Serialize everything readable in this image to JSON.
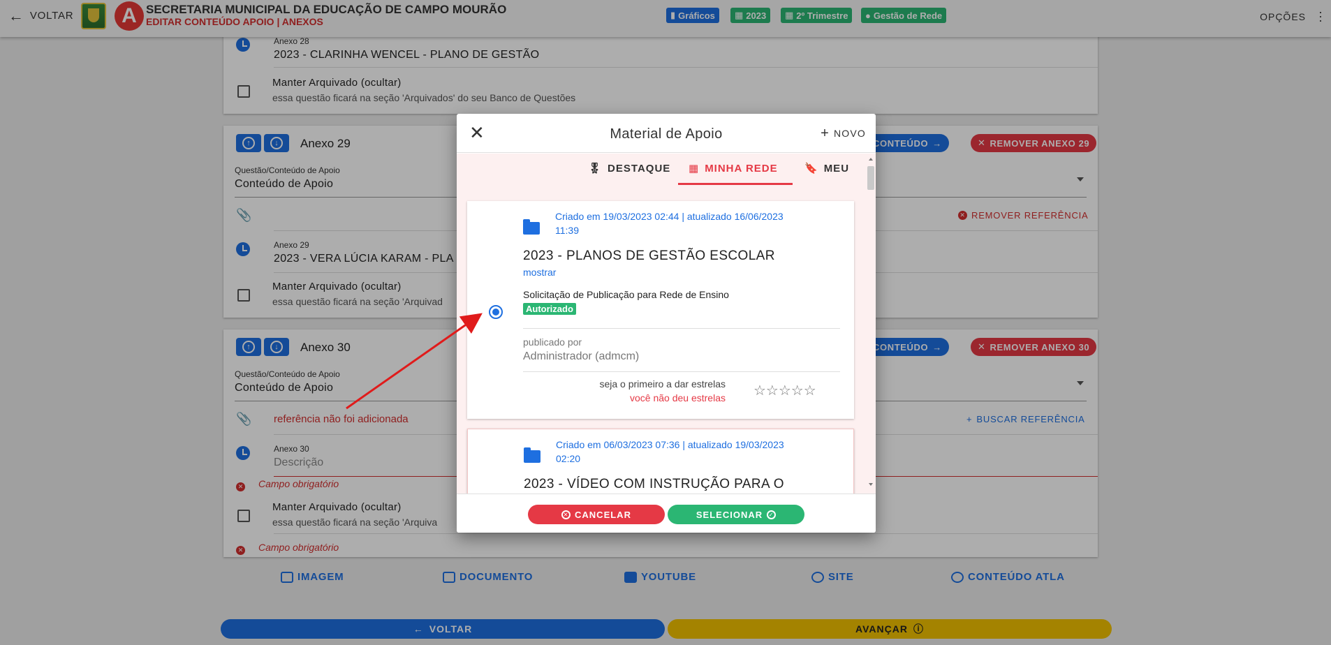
{
  "topbar": {
    "back_label": "VOLTAR",
    "org_title": "SECRETARIA MUNICIPAL DA EDUCAÇÃO DE CAMPO MOURÃO",
    "org_subtitle": "EDITAR CONTEÚDO APOIO | ANEXOS",
    "chips": [
      "Gráficos",
      "2023",
      "2º Trimestre",
      "Gestão de Rede"
    ],
    "options_label": "OPÇÕES"
  },
  "annex28": {
    "label": "Anexo 28",
    "value": "2023 - CLARINHA WENCEL - PLANO DE GESTÃO",
    "archive_label": "Manter Arquivado (ocultar)",
    "archive_hint": "essa questão ficará na seção 'Arquivados' do seu Banco de Questões"
  },
  "annex29": {
    "title": "Anexo 29",
    "content_btn": "CONTEÚDO",
    "remove_btn": "REMOVER ANEXO 29",
    "type_label": "Questão/Conteúdo de Apoio",
    "type_value": "Conteúdo de Apoio",
    "remove_ref": "REMOVER REFERÊNCIA",
    "desc_label": "Anexo 29",
    "desc_value": "2023 - VERA LÚCIA KARAM - PLA",
    "archive_label": "Manter Arquivado (ocultar)",
    "archive_hint": "essa questão ficará na seção 'Arquivad"
  },
  "annex30": {
    "title": "Anexo 30",
    "content_btn": "CONTEÚDO",
    "remove_btn": "REMOVER ANEXO 30",
    "type_label": "Questão/Conteúdo de Apoio",
    "type_value": "Conteúdo de Apoio",
    "ref_missing": "referência não foi adicionada",
    "search_ref": "BUSCAR REFERÊNCIA",
    "desc_label": "Anexo 30",
    "desc_placeholder": "Descrição",
    "required": "Campo obrigatório",
    "archive_label": "Manter Arquivado (ocultar)",
    "archive_hint": "essa questão ficará na seção 'Arquiva",
    "required2": "Campo obrigatório"
  },
  "attach_bar": [
    "IMAGEM",
    "DOCUMENTO",
    "YOUTUBE",
    "SITE",
    "CONTEÚDO ATLA"
  ],
  "bottom": {
    "back": "VOLTAR",
    "next": "AVANÇAR"
  },
  "modal": {
    "title": "Material de Apoio",
    "new_label": "NOVO",
    "tabs": [
      "DESTAQUE",
      "MINHA REDE",
      "MEU"
    ],
    "items": [
      {
        "meta_line1": "Criado em 19/03/2023 02:44 | atualizado 16/06/2023",
        "meta_line2": "11:39",
        "title": "2023 - PLANOS DE GESTÃO ESCOLAR",
        "show": "mostrar",
        "pub_request": "Solicitação de Publicação para Rede de Ensino",
        "badge": "Autorizado",
        "published_by_label": "publicado por",
        "published_by": "Administrador (admcm)",
        "stars_first": "seja o primeiro a dar estrelas",
        "stars_you": "você não deu estrelas",
        "stars": "☆☆☆☆☆"
      },
      {
        "meta_line1": "Criado em 06/03/2023 07:36 | atualizado 19/03/2023",
        "meta_line2": "02:20",
        "title": "2023 - VÍDEO COM INSTRUÇÃO PARA O"
      }
    ],
    "cancel": "CANCELAR",
    "select": "SELECIONAR"
  },
  "colors": {
    "primary": "#1e6fe0",
    "danger": "#e53945",
    "success": "#2bb673",
    "warning": "#f2c200"
  }
}
